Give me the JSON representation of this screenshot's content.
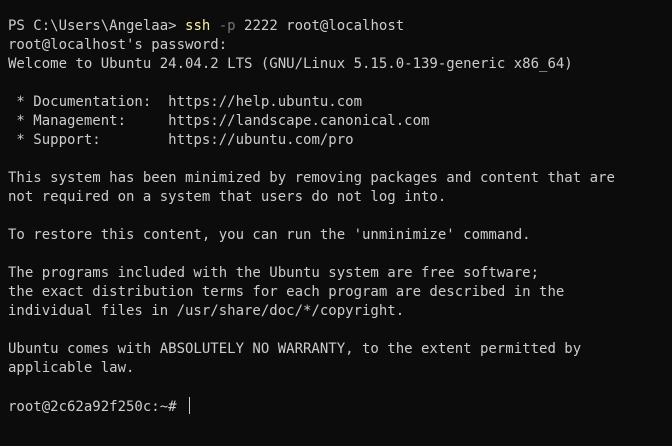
{
  "session": {
    "ps_prompt": "PS C:\\Users\\Angelaa> ",
    "command": {
      "program": "ssh",
      "flag": "-p",
      "args": " 2222 root@localhost"
    },
    "password_prompt": "root@localhost's password:",
    "welcome": "Welcome to Ubuntu 24.04.2 LTS (GNU/Linux 5.15.0-139-generic x86_64)"
  },
  "links": [
    {
      "label": " * Documentation:  ",
      "url": "https://help.ubuntu.com"
    },
    {
      "label": " * Management:     ",
      "url": "https://landscape.canonical.com"
    },
    {
      "label": " * Support:        ",
      "url": "https://ubuntu.com/pro"
    }
  ],
  "motd": {
    "minimized": [
      "This system has been minimized by removing packages and content that are",
      "not required on a system that users do not log into."
    ],
    "restore": "To restore this content, you can run the 'unminimize' command.",
    "programs": [
      "The programs included with the Ubuntu system are free software;",
      "the exact distribution terms for each program are described in the",
      "individual files in /usr/share/doc/*/copyright."
    ],
    "warranty": [
      "Ubuntu comes with ABSOLUTELY NO WARRANTY, to the extent permitted by",
      "applicable law."
    ]
  },
  "shell_prompt": "root@2c62a92f250c:~# ",
  "colors": {
    "background": "#0c0c0c",
    "foreground": "#cccccc",
    "command_highlight": "#f9f1a5",
    "flag": "#767676"
  }
}
